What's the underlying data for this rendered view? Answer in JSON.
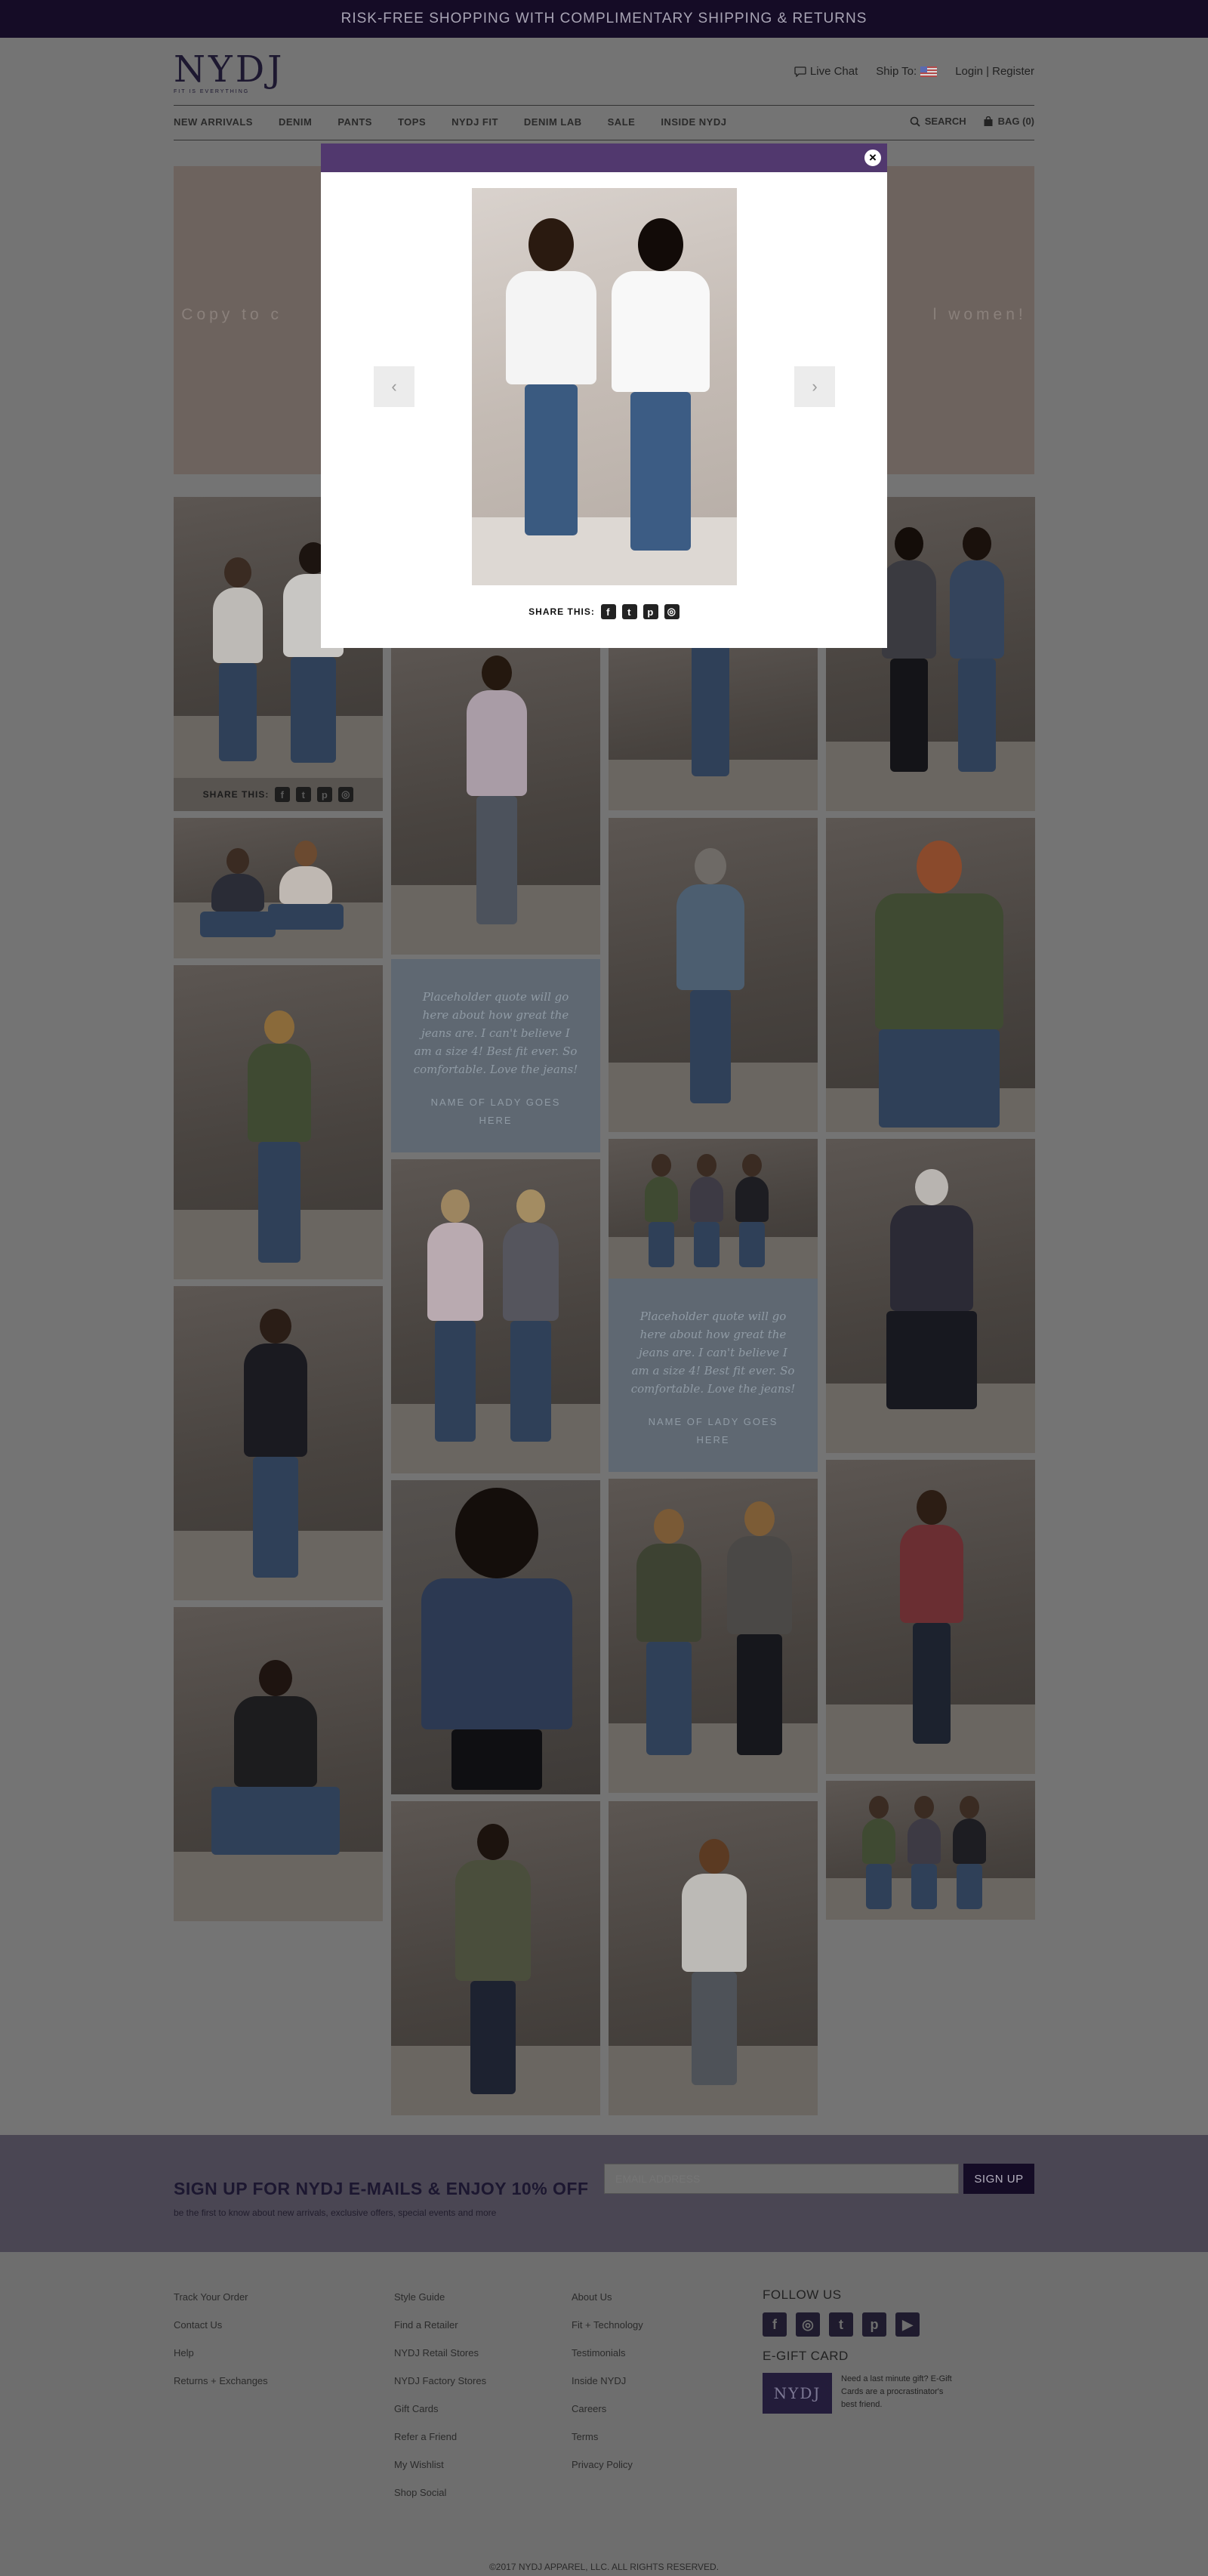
{
  "promo": {
    "text": "RISK-FREE SHOPPING WITH COMPLIMENTARY SHIPPING & RETURNS"
  },
  "header": {
    "logo": "NYDJ",
    "tagline": "FIT IS EVERYTHING",
    "live_chat": "Live Chat",
    "ship_to": "Ship To:",
    "login_register": "Login | Register"
  },
  "nav": {
    "items": [
      "NEW ARRIVALS",
      "DENIM",
      "PANTS",
      "TOPS",
      "NYDJ FIT",
      "DENIM LAB",
      "SALE",
      "INSIDE NYDJ"
    ],
    "search": "SEARCH",
    "bag": "BAG (0)"
  },
  "hero": {
    "copy_left": "Copy to c",
    "copy_right": "l women!"
  },
  "gallery": {
    "share_label": "SHARE THIS:",
    "quotes": [
      {
        "text": "Placeholder quote will go here about how great the jeans are. I can't believe I am a size 4! Best fit ever. So comfortable. Love the jeans!",
        "name": "NAME OF LADY GOES HERE"
      },
      {
        "text": "Placeholder quote will go here about how great the jeans are. I can't believe I am a size 4! Best fit ever. So comfortable. Love the jeans!",
        "name": "NAME OF LADY GOES HERE"
      }
    ]
  },
  "modal": {
    "share_label": "SHARE THIS:",
    "prev": "‹",
    "next": "›",
    "close": "×"
  },
  "newsletter": {
    "title": "SIGN UP FOR NYDJ E-MAILS & ENJOY 10% OFF",
    "subtitle": "be the first to know about new arrivals, exclusive offers, special events and more",
    "placeholder": "EMAIL ADDRESS",
    "button": "SIGN UP"
  },
  "footer": {
    "col1": [
      "Track Your Order",
      "Contact Us",
      "Help",
      "Returns + Exchanges"
    ],
    "col2": [
      "Style Guide",
      "Find a Retailer",
      "NYDJ Retail Stores",
      "NYDJ Factory Stores",
      "Gift Cards",
      "Refer a Friend",
      "My Wishlist",
      "Shop Social"
    ],
    "col3": [
      "About Us",
      "Fit + Technology",
      "Testimonials",
      "Inside NYDJ",
      "Careers",
      "Terms",
      "Privacy Policy"
    ],
    "follow_title": "FOLLOW US",
    "egift_title": "E-GIFT CARD",
    "egift_card": "NYDJ",
    "egift_text": "Need a last minute gift? E-Gift Cards are a procrastinator's best friend.",
    "copyright": "©2017 NYDJ APPAREL, LLC. ALL RIGHTS RESERVED."
  },
  "colors": {
    "brand_dark": "#150c26",
    "modal_bar": "#51386e",
    "overlay_gray": "#747474",
    "quote_panel": "#5f6872"
  },
  "icons": [
    "chat-icon",
    "us-flag-icon",
    "search-icon",
    "bag-icon",
    "facebook-icon",
    "twitter-icon",
    "pinterest-icon",
    "instagram-icon",
    "youtube-icon",
    "close-icon",
    "chevron-left-icon",
    "chevron-right-icon"
  ]
}
